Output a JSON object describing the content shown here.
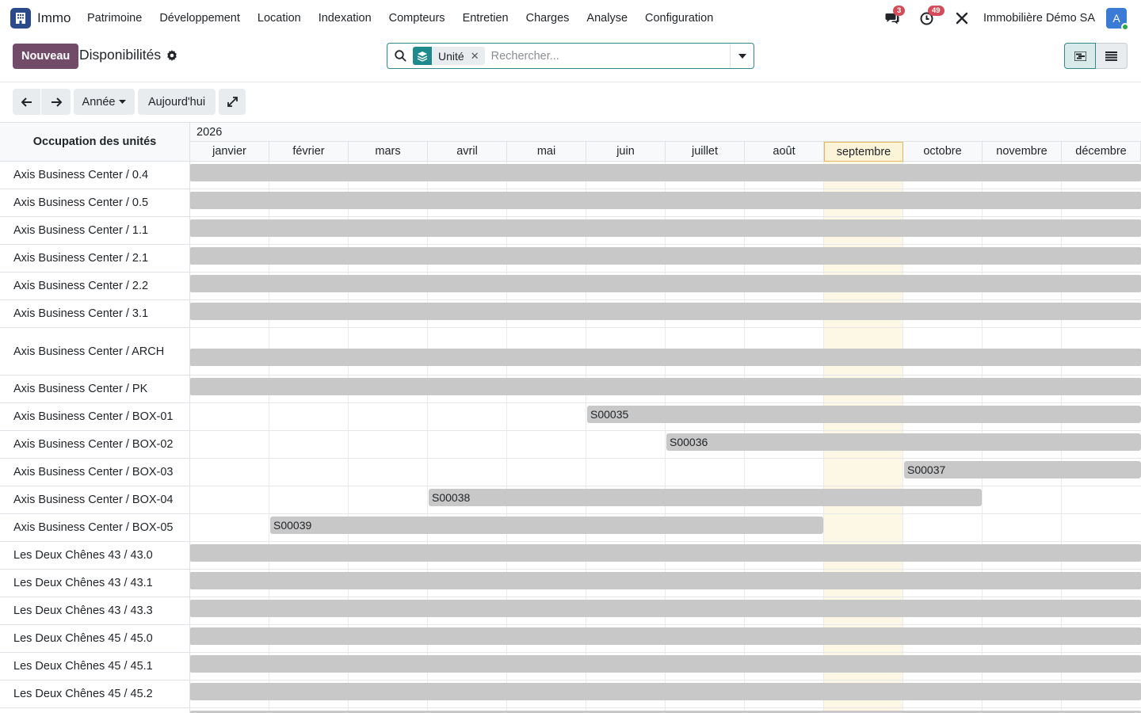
{
  "app": {
    "name": "Immo"
  },
  "menu": [
    "Patrimoine",
    "Développement",
    "Location",
    "Indexation",
    "Compteurs",
    "Entretien",
    "Charges",
    "Analyse",
    "Configuration"
  ],
  "tray": {
    "messages_count": "3",
    "activities_count": "49",
    "company": "Immobilière Démo SA",
    "avatar_letter": "A"
  },
  "control": {
    "new_label": "Nouveau",
    "title": "Disponibilités"
  },
  "search": {
    "facet_label": "Unité",
    "placeholder": "Rechercher..."
  },
  "toolbar": {
    "scale_label": "Année",
    "today_label": "Aujourd'hui"
  },
  "gantt": {
    "header_label": "Occupation des unités",
    "year": "2026",
    "months": [
      "janvier",
      "février",
      "mars",
      "avril",
      "mai",
      "juin",
      "juillet",
      "août",
      "septembre",
      "octobre",
      "novembre",
      "décembre"
    ],
    "current_month_index": 8,
    "rows": [
      {
        "label": "Axis Business Center / 0.4",
        "bars": [
          {
            "start": 0,
            "end": 12,
            "text": ""
          }
        ]
      },
      {
        "label": "Axis Business Center / 0.5",
        "bars": [
          {
            "start": 0,
            "end": 12,
            "text": ""
          }
        ]
      },
      {
        "label": "Axis Business Center / 1.1",
        "bars": [
          {
            "start": 0,
            "end": 12,
            "text": ""
          }
        ]
      },
      {
        "label": "Axis Business Center / 2.1",
        "bars": [
          {
            "start": 0,
            "end": 12,
            "text": ""
          }
        ]
      },
      {
        "label": "Axis Business Center / 2.2",
        "bars": [
          {
            "start": 0,
            "end": 12,
            "text": ""
          }
        ]
      },
      {
        "label": "Axis Business Center / 3.1",
        "bars": [
          {
            "start": 0,
            "end": 12,
            "text": ""
          }
        ]
      },
      {
        "label": "Axis Business Center / ARCH",
        "tall": true,
        "bars": [
          {
            "start": 0,
            "end": 12,
            "text": ""
          }
        ]
      },
      {
        "label": "Axis Business Center / PK",
        "bars": [
          {
            "start": 0,
            "end": 12,
            "text": ""
          }
        ]
      },
      {
        "label": "Axis Business Center / BOX-01",
        "bars": [
          {
            "start": 5,
            "end": 12,
            "text": "S00035"
          }
        ]
      },
      {
        "label": "Axis Business Center / BOX-02",
        "bars": [
          {
            "start": 6,
            "end": 12,
            "text": "S00036"
          }
        ]
      },
      {
        "label": "Axis Business Center / BOX-03",
        "bars": [
          {
            "start": 9,
            "end": 12,
            "text": "S00037"
          }
        ]
      },
      {
        "label": "Axis Business Center / BOX-04",
        "bars": [
          {
            "start": 3,
            "end": 10,
            "text": "S00038"
          }
        ]
      },
      {
        "label": "Axis Business Center / BOX-05",
        "bars": [
          {
            "start": 1,
            "end": 8,
            "text": "S00039"
          }
        ]
      },
      {
        "label": "Les Deux Chênes 43 / 43.0",
        "bars": [
          {
            "start": 0,
            "end": 12,
            "text": ""
          }
        ]
      },
      {
        "label": "Les Deux Chênes 43 / 43.1",
        "bars": [
          {
            "start": 0,
            "end": 12,
            "text": ""
          }
        ]
      },
      {
        "label": "Les Deux Chênes 43 / 43.3",
        "bars": [
          {
            "start": 0,
            "end": 12,
            "text": ""
          }
        ]
      },
      {
        "label": "Les Deux Chênes 45 / 45.0",
        "bars": [
          {
            "start": 0,
            "end": 12,
            "text": ""
          }
        ]
      },
      {
        "label": "Les Deux Chênes 45 / 45.1",
        "bars": [
          {
            "start": 0,
            "end": 12,
            "text": ""
          }
        ]
      },
      {
        "label": "Les Deux Chênes 45 / 45.2",
        "bars": [
          {
            "start": 0,
            "end": 12,
            "text": ""
          }
        ]
      }
    ]
  }
}
